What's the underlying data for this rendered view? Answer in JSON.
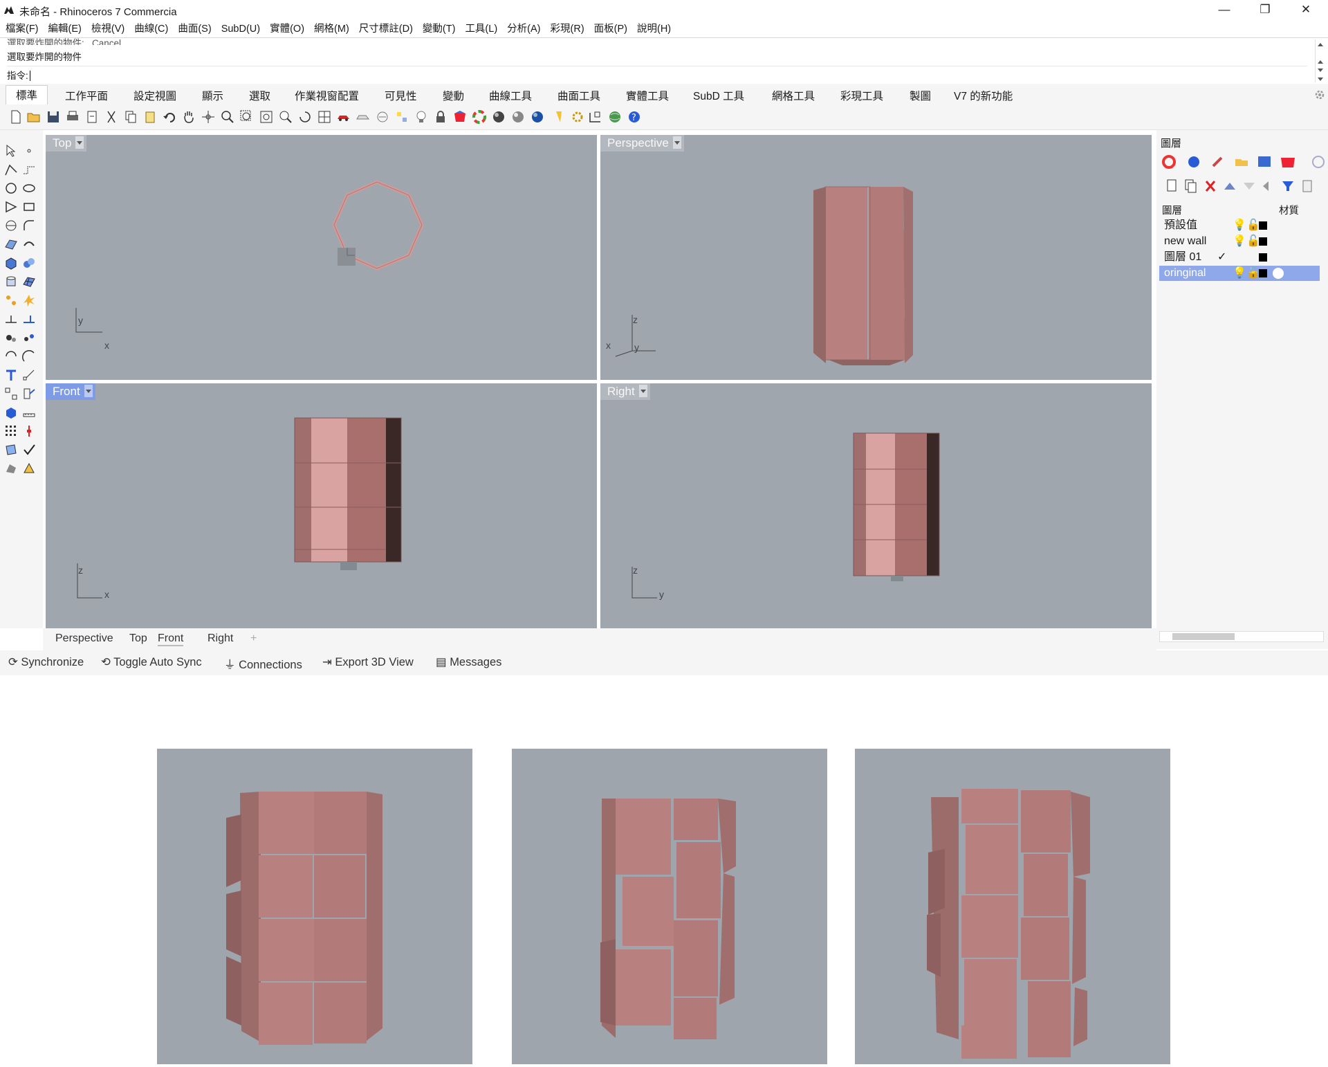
{
  "window": {
    "title": "未命名 - Rhinoceros 7 Commercia",
    "controls": {
      "minimize": "—",
      "restore": "❐",
      "close": "✕"
    }
  },
  "menu": [
    "檔案(F)",
    "編輯(E)",
    "檢視(V)",
    "曲線(C)",
    "曲面(S)",
    "SubD(U)",
    "實體(O)",
    "網格(M)",
    "尺寸標註(D)",
    "變動(T)",
    "工具(L)",
    "分析(A)",
    "彩現(R)",
    "面板(P)",
    "說明(H)"
  ],
  "command": {
    "history_1": "選取要炸開的物件: _Cancel",
    "history_2": "選取要炸開的物件",
    "prompt": "指令:"
  },
  "tabs": [
    "標準",
    "工作平面",
    "設定視圖",
    "顯示",
    "選取",
    "作業視窗配置",
    "可見性",
    "變動",
    "曲線工具",
    "曲面工具",
    "實體工具",
    "SubD 工具",
    "網格工具",
    "彩現工具",
    "製圖",
    "V7 的新功能"
  ],
  "viewports": {
    "top": {
      "label": "Top",
      "axis_1": "y",
      "axis_2": "x"
    },
    "perspective": {
      "label": "Perspective",
      "axis_1": "z",
      "axis_2": "x",
      "axis_3": "y"
    },
    "front": {
      "label": "Front",
      "axis_1": "z",
      "axis_2": "x"
    },
    "right": {
      "label": "Right",
      "axis_1": "z",
      "axis_2": "y"
    }
  },
  "viewport_tabs": [
    "Perspective",
    "Top",
    "Front",
    "Right",
    "+"
  ],
  "sync_bar": {
    "synchronize": "Synchronize",
    "toggle_auto_sync": "Toggle Auto Sync",
    "connections": "Connections",
    "export_3d_view": "Export 3D View",
    "messages": "Messages"
  },
  "layers_panel": {
    "title": "圖層",
    "col_name": "圖層",
    "col_material": "材質",
    "rows": [
      {
        "name": "預設值"
      },
      {
        "name": "new wall"
      },
      {
        "name": "圖層 01",
        "current": "✓"
      },
      {
        "name": "oringinal"
      }
    ]
  },
  "colors": {
    "viewport_bg": "#9fa6ae",
    "model_face": "#b8807e",
    "model_face_light": "#d8a3a0",
    "model_dark": "#3a2827",
    "active_label": "#7e9be6",
    "selected_layer": "#8fa8ea"
  }
}
